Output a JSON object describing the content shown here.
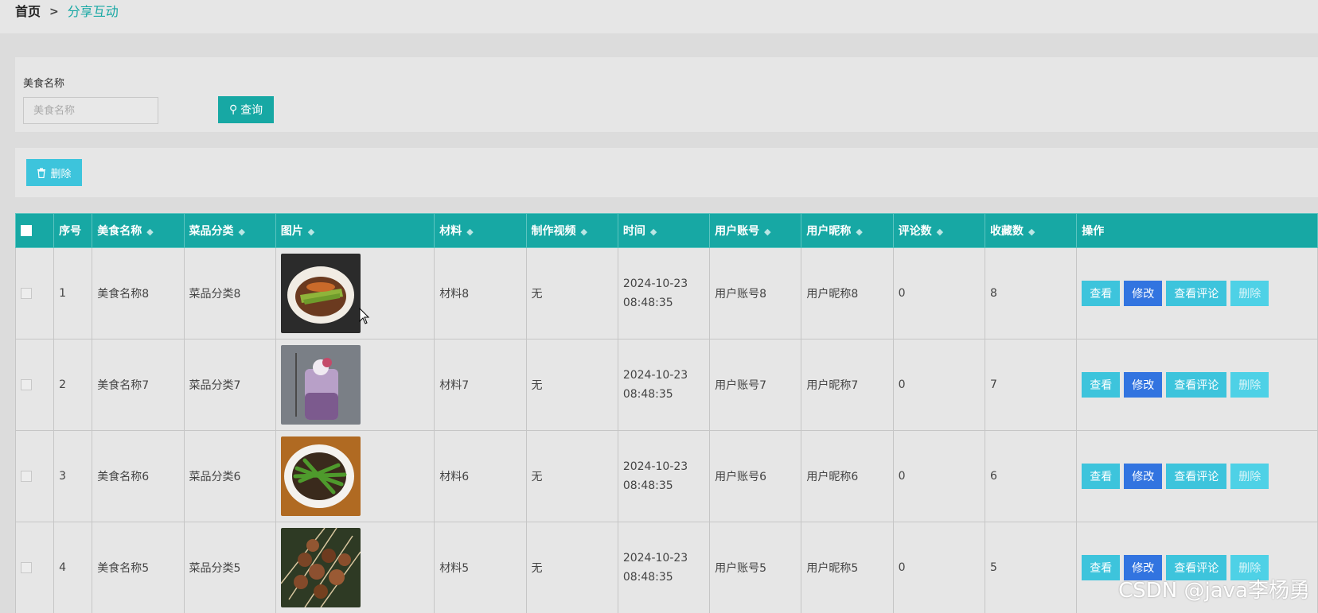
{
  "breadcrumb": {
    "home": "首页",
    "sep": ">",
    "current": "分享互动"
  },
  "search": {
    "label": "美食名称",
    "placeholder": "美食名称",
    "button_label": "查询",
    "icon": "search-icon"
  },
  "actions": {
    "delete_label": "删除",
    "icon": "trash-icon"
  },
  "table": {
    "headers": [
      "序号",
      "美食名称",
      "菜品分类",
      "图片",
      "材料",
      "制作视频",
      "时间",
      "用户账号",
      "用户昵称",
      "评论数",
      "收藏数",
      "操作"
    ],
    "rows": [
      {
        "no": "1",
        "name": "美食名称8",
        "category": "菜品分类8",
        "image": "green-beans-dish",
        "material": "材料8",
        "video": "无",
        "time": "2024-10-23 08:48:35",
        "account": "用户账号8",
        "nickname": "用户昵称8",
        "comments": "0",
        "favorites": "8"
      },
      {
        "no": "2",
        "name": "美食名称7",
        "category": "菜品分类7",
        "image": "berry-smoothie",
        "material": "材料7",
        "video": "无",
        "time": "2024-10-23 08:48:35",
        "account": "用户账号7",
        "nickname": "用户昵称7",
        "comments": "0",
        "favorites": "7"
      },
      {
        "no": "3",
        "name": "美食名称6",
        "category": "菜品分类6",
        "image": "stir-fry-beans-beef",
        "material": "材料6",
        "video": "无",
        "time": "2024-10-23 08:48:35",
        "account": "用户账号6",
        "nickname": "用户昵称6",
        "comments": "0",
        "favorites": "6"
      },
      {
        "no": "4",
        "name": "美食名称5",
        "category": "菜品分类5",
        "image": "meat-skewers",
        "material": "材料5",
        "video": "无",
        "time": "2024-10-23 08:48:35",
        "account": "用户账号5",
        "nickname": "用户昵称5",
        "comments": "0",
        "favorites": "5"
      }
    ],
    "row_actions": {
      "view": "查看",
      "edit": "修改",
      "comments": "查看评论",
      "delete": "删除"
    }
  },
  "colors": {
    "accent": "#17a8a4",
    "info": "#3dc4dc",
    "primary": "#3274e0"
  },
  "watermark": "CSDN @java李杨勇"
}
